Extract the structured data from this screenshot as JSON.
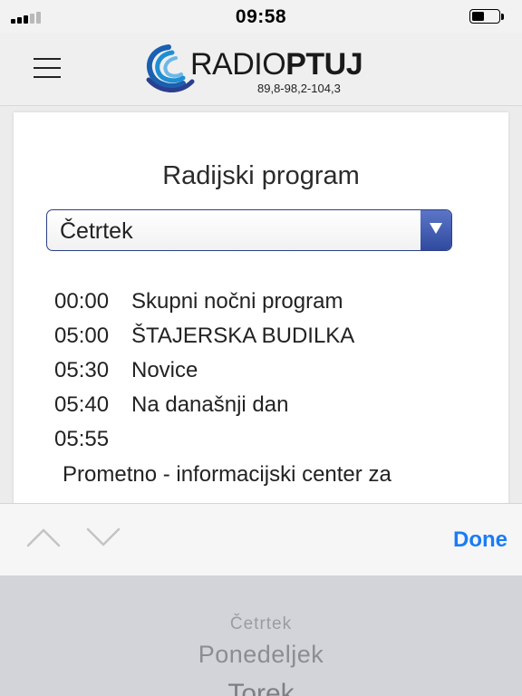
{
  "status_bar": {
    "time": "09:58",
    "signal_bars_active": 3,
    "signal_bars_total": 5,
    "battery_level": 0.45
  },
  "header": {
    "menu_icon": "hamburger-menu-icon",
    "logo": {
      "name_regular": "RADIO",
      "name_bold": "PTUJ",
      "frequencies": "89,8-98,2-104,3"
    }
  },
  "main": {
    "title": "Radijski program",
    "day_select": {
      "selected": "Četrtek"
    },
    "schedule": [
      {
        "time": "00:00",
        "program": "Skupni nočni program"
      },
      {
        "time": "05:00",
        "program": "ŠTAJERSKA BUDILKA"
      },
      {
        "time": "05:30",
        "program": "Novice"
      },
      {
        "time": "05:40",
        "program": "Na današnji dan"
      },
      {
        "time": "05:55",
        "program": ""
      }
    ],
    "note": "Prometno - informacijski center za"
  },
  "picker_toolbar": {
    "prev_icon": "chevron-up-icon",
    "next_icon": "chevron-down-icon",
    "done_label": "Done"
  },
  "picker_wheel": {
    "options": [
      "Četrtek",
      "Ponedeljek",
      "Torek"
    ]
  },
  "colors": {
    "accent": "#1a7cf5",
    "select_border": "#2c3f86",
    "select_button": "#3f5bb3",
    "logo_swirl": "#1f8fd3"
  }
}
